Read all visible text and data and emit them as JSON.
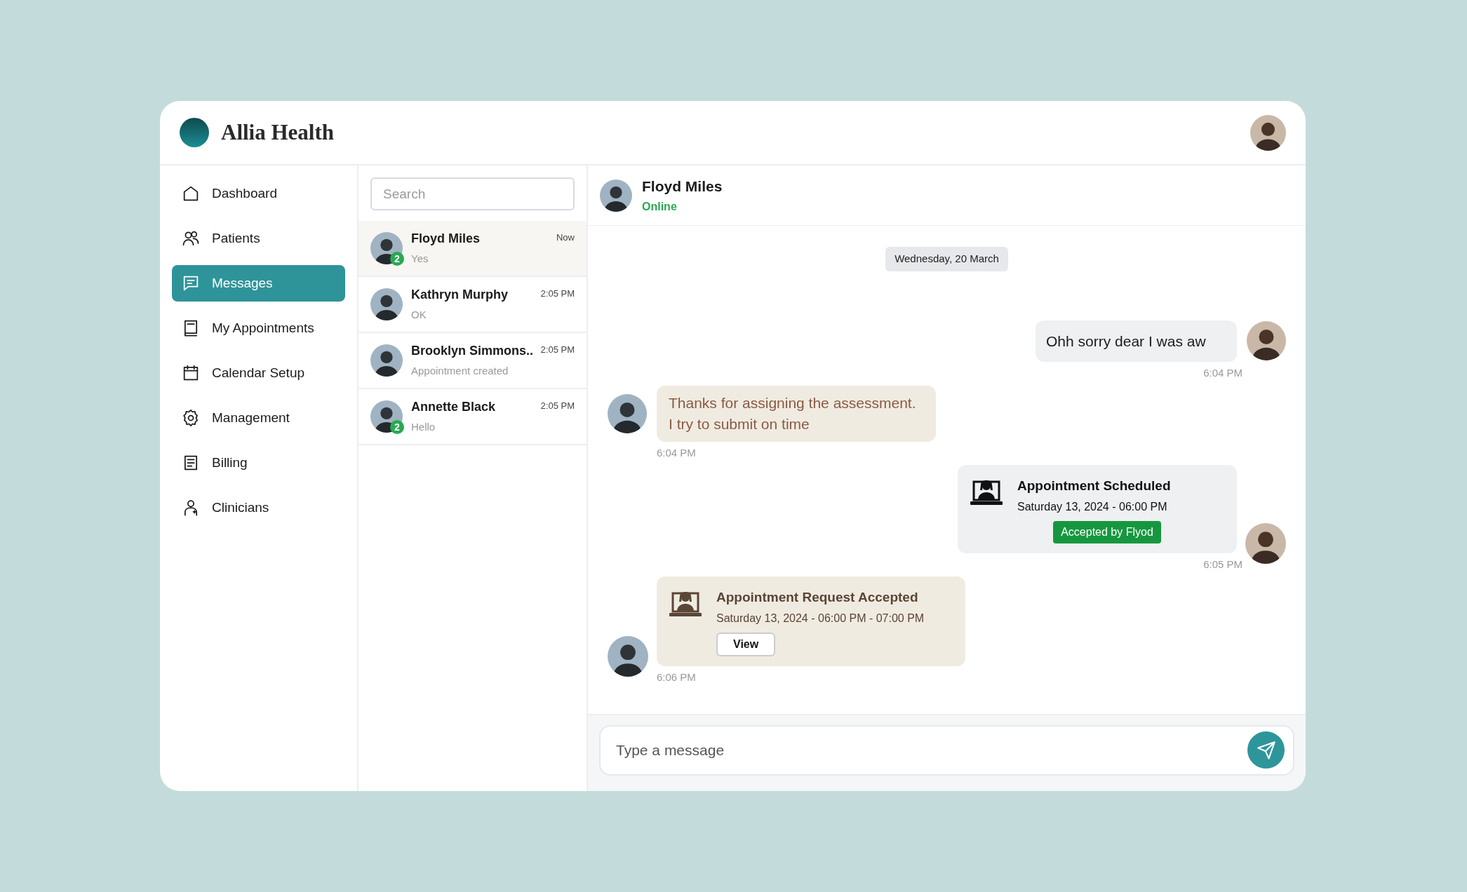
{
  "app": {
    "title": "Allia Health"
  },
  "sidebar": {
    "items": [
      {
        "label": "Dashboard",
        "selected": false
      },
      {
        "label": "Patients",
        "selected": false
      },
      {
        "label": "Messages",
        "selected": true
      },
      {
        "label": "My Appointments",
        "selected": false
      },
      {
        "label": "Calendar Setup",
        "selected": false
      },
      {
        "label": "Management",
        "selected": false
      },
      {
        "label": "Billing",
        "selected": false
      },
      {
        "label": "Clinicians",
        "selected": false
      }
    ]
  },
  "conversations": {
    "search": {
      "placeholder": "Search"
    },
    "items": [
      {
        "name": "Floyd Miles",
        "time": "Now",
        "preview": "Yes",
        "unread": "2",
        "selected": true
      },
      {
        "name": "Kathryn Murphy",
        "time": "2:05 PM",
        "preview": "OK",
        "selected": false
      },
      {
        "name": "Brooklyn Simmons..",
        "time": "2:05 PM",
        "preview": "Appointment created",
        "selected": false
      },
      {
        "name": "Annette Black",
        "time": "2:05 PM",
        "preview": "Hello",
        "unread": "2",
        "selected": false
      }
    ]
  },
  "chat": {
    "contact": {
      "name": "Floyd Miles",
      "status": "Online"
    },
    "date": "Wednesday, 20 March",
    "messages": [
      {
        "kind": "text",
        "outgoing": true,
        "text": "Ohh sorry dear I was aw",
        "time": "6:04 PM"
      },
      {
        "kind": "text",
        "outgoing": false,
        "text": "Thanks for assigning the assessment. I try to submit on time",
        "time": "6:04 PM"
      },
      {
        "kind": "card",
        "outgoing": true,
        "title": "Appointment Scheduled",
        "detail": "Saturday 13, 2024 - 06:00 PM",
        "badge": "Accepted by Flyod",
        "time": "6:05 PM"
      },
      {
        "kind": "card",
        "outgoing": false,
        "title": "Appointment Request Accepted",
        "detail": "Saturday 13, 2024 - 06:00 PM - 07:00 PM",
        "button": "View",
        "time": "6:06 PM"
      }
    ],
    "composer": {
      "placeholder": "Type a message"
    }
  }
}
